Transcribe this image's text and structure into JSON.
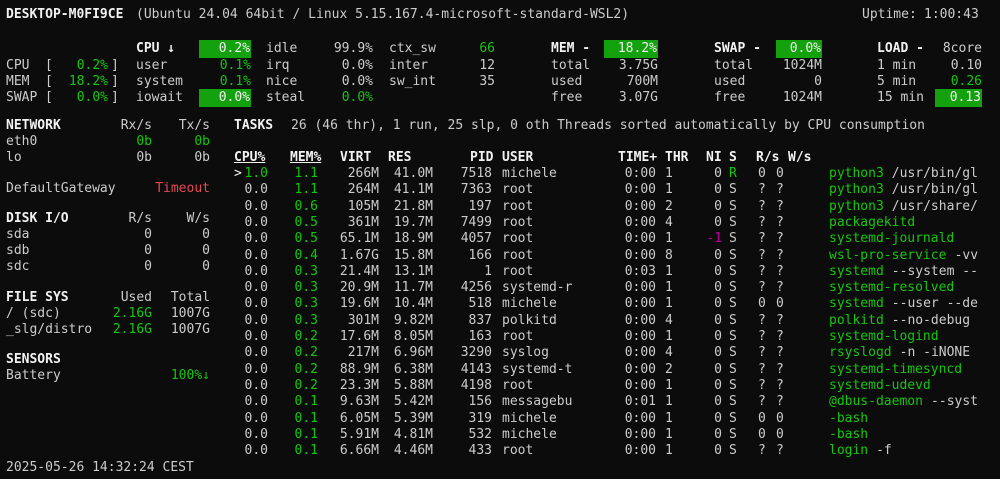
{
  "header": {
    "host": "DESKTOP-M0FI9CE",
    "system": "(Ubuntu 24.04 64bit / Linux 5.15.167.4-microsoft-standard-WSL2)",
    "uptime_label": "Uptime:",
    "uptime": "1:00:43"
  },
  "quicklook": {
    "cpu_label": "CPU",
    "cpu_value": "0.2%",
    "mem_label": "MEM",
    "mem_value": "18.2%",
    "swap_label": "SWAP",
    "swap_value": "0.0%",
    "lbracket": "[",
    "rbracket": "]"
  },
  "cpu": {
    "title": "CPU ↓",
    "total": "0.2%",
    "rows": [
      {
        "label": "user",
        "value": "0.1%"
      },
      {
        "label": "system",
        "value": "0.1%"
      },
      {
        "label": "iowait",
        "value": "0.0%"
      }
    ],
    "rows2": [
      {
        "label": "idle",
        "value": "99.9%"
      },
      {
        "label": "irq",
        "value": "0.0%"
      },
      {
        "label": "nice",
        "value": "0.0%"
      },
      {
        "label": "steal",
        "value": "0.0%"
      }
    ],
    "rows3": [
      {
        "label": "ctx_sw",
        "value": "66"
      },
      {
        "label": "inter",
        "value": "12"
      },
      {
        "label": "sw_int",
        "value": "35"
      }
    ]
  },
  "mem": {
    "title": "MEM -",
    "percent": "18.2%",
    "rows": [
      {
        "label": "total",
        "value": "3.75G"
      },
      {
        "label": "used",
        "value": "700M"
      },
      {
        "label": "free",
        "value": "3.07G"
      }
    ]
  },
  "swap": {
    "title": "SWAP -",
    "percent": "0.0%",
    "rows": [
      {
        "label": "total",
        "value": "1024M"
      },
      {
        "label": "used",
        "value": "0"
      },
      {
        "label": "free",
        "value": "1024M"
      }
    ]
  },
  "load": {
    "title": "LOAD -",
    "cores": "8core",
    "rows": [
      {
        "label": "1 min",
        "value": "0.10"
      },
      {
        "label": "5 min",
        "value": "0.26"
      },
      {
        "label": "15 min",
        "value": "0.13"
      }
    ]
  },
  "network": {
    "title": "NETWORK",
    "rx": "Rx/s",
    "tx": "Tx/s",
    "rows": [
      {
        "name": "eth0",
        "rx": "0b",
        "tx": "0b"
      },
      {
        "name": "lo",
        "rx": "0b",
        "tx": "0b"
      }
    ]
  },
  "gateway": {
    "label": "DefaultGateway",
    "status": "Timeout"
  },
  "diskio": {
    "title": "DISK I/O",
    "r": "R/s",
    "w": "W/s",
    "rows": [
      {
        "name": "sda",
        "r": "0",
        "w": "0"
      },
      {
        "name": "sdb",
        "r": "0",
        "w": "0"
      },
      {
        "name": "sdc",
        "r": "0",
        "w": "0"
      }
    ]
  },
  "fs": {
    "title": "FILE SYS",
    "used": "Used",
    "total": "Total",
    "rows": [
      {
        "name": "/ (sdc)",
        "used": "2.16G",
        "total": "1007G"
      },
      {
        "name": "_slg/distro",
        "used": "2.16G",
        "total": "1007G"
      }
    ]
  },
  "sensors": {
    "title": "SENSORS",
    "battery_label": "Battery",
    "battery_value": "100%↓"
  },
  "tasks": {
    "title": "TASKS",
    "summary": "26 (46 thr), 1 run, 25 slp, 0 oth Threads sorted automatically by CPU consumption"
  },
  "proc": {
    "headers": [
      "CPU%",
      "MEM%",
      "VIRT",
      "RES",
      "PID",
      "USER",
      "TIME+",
      "THR",
      "NI",
      "S",
      "R/s",
      "W/s"
    ],
    "rows": [
      {
        "sel": ">",
        "cpu": "1.0",
        "mem": "1.1",
        "virt": "266M",
        "res": "41.0M",
        "pid": "7518",
        "user": "michele",
        "time": "0:00",
        "thr": "1",
        "ni": "0",
        "s": "R",
        "r": "0",
        "w": "0",
        "cmd": "python3",
        "args": "/usr/bin/gl"
      },
      {
        "sel": "",
        "cpu": "0.0",
        "mem": "1.1",
        "virt": "264M",
        "res": "41.1M",
        "pid": "7363",
        "user": "root",
        "time": "0:00",
        "thr": "1",
        "ni": "0",
        "s": "S",
        "r": "?",
        "w": "?",
        "cmd": "python3",
        "args": "/usr/bin/gl"
      },
      {
        "sel": "",
        "cpu": "0.0",
        "mem": "0.6",
        "virt": "105M",
        "res": "21.8M",
        "pid": "197",
        "user": "root",
        "time": "0:00",
        "thr": "2",
        "ni": "0",
        "s": "S",
        "r": "?",
        "w": "?",
        "cmd": "python3",
        "args": "/usr/share/"
      },
      {
        "sel": "",
        "cpu": "0.0",
        "mem": "0.5",
        "virt": "361M",
        "res": "19.7M",
        "pid": "7499",
        "user": "root",
        "time": "0:00",
        "thr": "4",
        "ni": "0",
        "s": "S",
        "r": "?",
        "w": "?",
        "cmd": "packagekitd",
        "args": ""
      },
      {
        "sel": "",
        "cpu": "0.0",
        "mem": "0.5",
        "virt": "65.1M",
        "res": "18.9M",
        "pid": "4057",
        "user": "root",
        "time": "0:00",
        "thr": "1",
        "ni": "-1",
        "s": "S",
        "r": "?",
        "w": "?",
        "cmd": "systemd-journald",
        "args": ""
      },
      {
        "sel": "",
        "cpu": "0.0",
        "mem": "0.4",
        "virt": "1.67G",
        "res": "15.8M",
        "pid": "166",
        "user": "root",
        "time": "0:00",
        "thr": "8",
        "ni": "0",
        "s": "S",
        "r": "?",
        "w": "?",
        "cmd": "wsl-pro-service",
        "args": "-vv"
      },
      {
        "sel": "",
        "cpu": "0.0",
        "mem": "0.3",
        "virt": "21.4M",
        "res": "13.1M",
        "pid": "1",
        "user": "root",
        "time": "0:03",
        "thr": "1",
        "ni": "0",
        "s": "S",
        "r": "?",
        "w": "?",
        "cmd": "systemd",
        "args": "--system --"
      },
      {
        "sel": "",
        "cpu": "0.0",
        "mem": "0.3",
        "virt": "20.9M",
        "res": "11.7M",
        "pid": "4256",
        "user": "systemd-r",
        "time": "0:00",
        "thr": "1",
        "ni": "0",
        "s": "S",
        "r": "?",
        "w": "?",
        "cmd": "systemd-resolved",
        "args": ""
      },
      {
        "sel": "",
        "cpu": "0.0",
        "mem": "0.3",
        "virt": "19.6M",
        "res": "10.4M",
        "pid": "518",
        "user": "michele",
        "time": "0:00",
        "thr": "1",
        "ni": "0",
        "s": "S",
        "r": "0",
        "w": "0",
        "cmd": "systemd",
        "args": "--user --de"
      },
      {
        "sel": "",
        "cpu": "0.0",
        "mem": "0.3",
        "virt": "301M",
        "res": "9.82M",
        "pid": "837",
        "user": "polkitd",
        "time": "0:00",
        "thr": "4",
        "ni": "0",
        "s": "S",
        "r": "?",
        "w": "?",
        "cmd": "polkitd",
        "args": "--no-debug"
      },
      {
        "sel": "",
        "cpu": "0.0",
        "mem": "0.2",
        "virt": "17.6M",
        "res": "8.05M",
        "pid": "163",
        "user": "root",
        "time": "0:00",
        "thr": "1",
        "ni": "0",
        "s": "S",
        "r": "?",
        "w": "?",
        "cmd": "systemd-logind",
        "args": ""
      },
      {
        "sel": "",
        "cpu": "0.0",
        "mem": "0.2",
        "virt": "217M",
        "res": "6.96M",
        "pid": "3290",
        "user": "syslog",
        "time": "0:00",
        "thr": "4",
        "ni": "0",
        "s": "S",
        "r": "?",
        "w": "?",
        "cmd": "rsyslogd",
        "args": "-n -iNONE"
      },
      {
        "sel": "",
        "cpu": "0.0",
        "mem": "0.2",
        "virt": "88.9M",
        "res": "6.38M",
        "pid": "4143",
        "user": "systemd-t",
        "time": "0:00",
        "thr": "2",
        "ni": "0",
        "s": "S",
        "r": "?",
        "w": "?",
        "cmd": "systemd-timesyncd",
        "args": ""
      },
      {
        "sel": "",
        "cpu": "0.0",
        "mem": "0.2",
        "virt": "23.3M",
        "res": "5.88M",
        "pid": "4198",
        "user": "root",
        "time": "0:00",
        "thr": "1",
        "ni": "0",
        "s": "S",
        "r": "?",
        "w": "?",
        "cmd": "systemd-udevd",
        "args": ""
      },
      {
        "sel": "",
        "cpu": "0.0",
        "mem": "0.1",
        "virt": "9.63M",
        "res": "5.42M",
        "pid": "156",
        "user": "messagebu",
        "time": "0:01",
        "thr": "1",
        "ni": "0",
        "s": "S",
        "r": "?",
        "w": "?",
        "cmd": "@dbus-daemon",
        "args": "--syst"
      },
      {
        "sel": "",
        "cpu": "0.0",
        "mem": "0.1",
        "virt": "6.05M",
        "res": "5.39M",
        "pid": "319",
        "user": "michele",
        "time": "0:00",
        "thr": "1",
        "ni": "0",
        "s": "S",
        "r": "0",
        "w": "0",
        "cmd": "-bash",
        "args": ""
      },
      {
        "sel": "",
        "cpu": "0.0",
        "mem": "0.1",
        "virt": "5.91M",
        "res": "4.81M",
        "pid": "532",
        "user": "michele",
        "time": "0:00",
        "thr": "1",
        "ni": "0",
        "s": "S",
        "r": "0",
        "w": "0",
        "cmd": "-bash",
        "args": ""
      },
      {
        "sel": "",
        "cpu": "0.0",
        "mem": "0.1",
        "virt": "6.66M",
        "res": "4.46M",
        "pid": "433",
        "user": "root",
        "time": "0:00",
        "thr": "1",
        "ni": "0",
        "s": "S",
        "r": "?",
        "w": "?",
        "cmd": "login",
        "args": "-f"
      }
    ]
  },
  "footer": {
    "datetime": "2025-05-26 14:32:24 CEST"
  },
  "colors": {
    "background": "#0c0c0c",
    "text": "#cccccc",
    "green": "#16c60c",
    "highlight": "#13a10e",
    "red": "#e74856",
    "magenta": "#b4009e"
  }
}
